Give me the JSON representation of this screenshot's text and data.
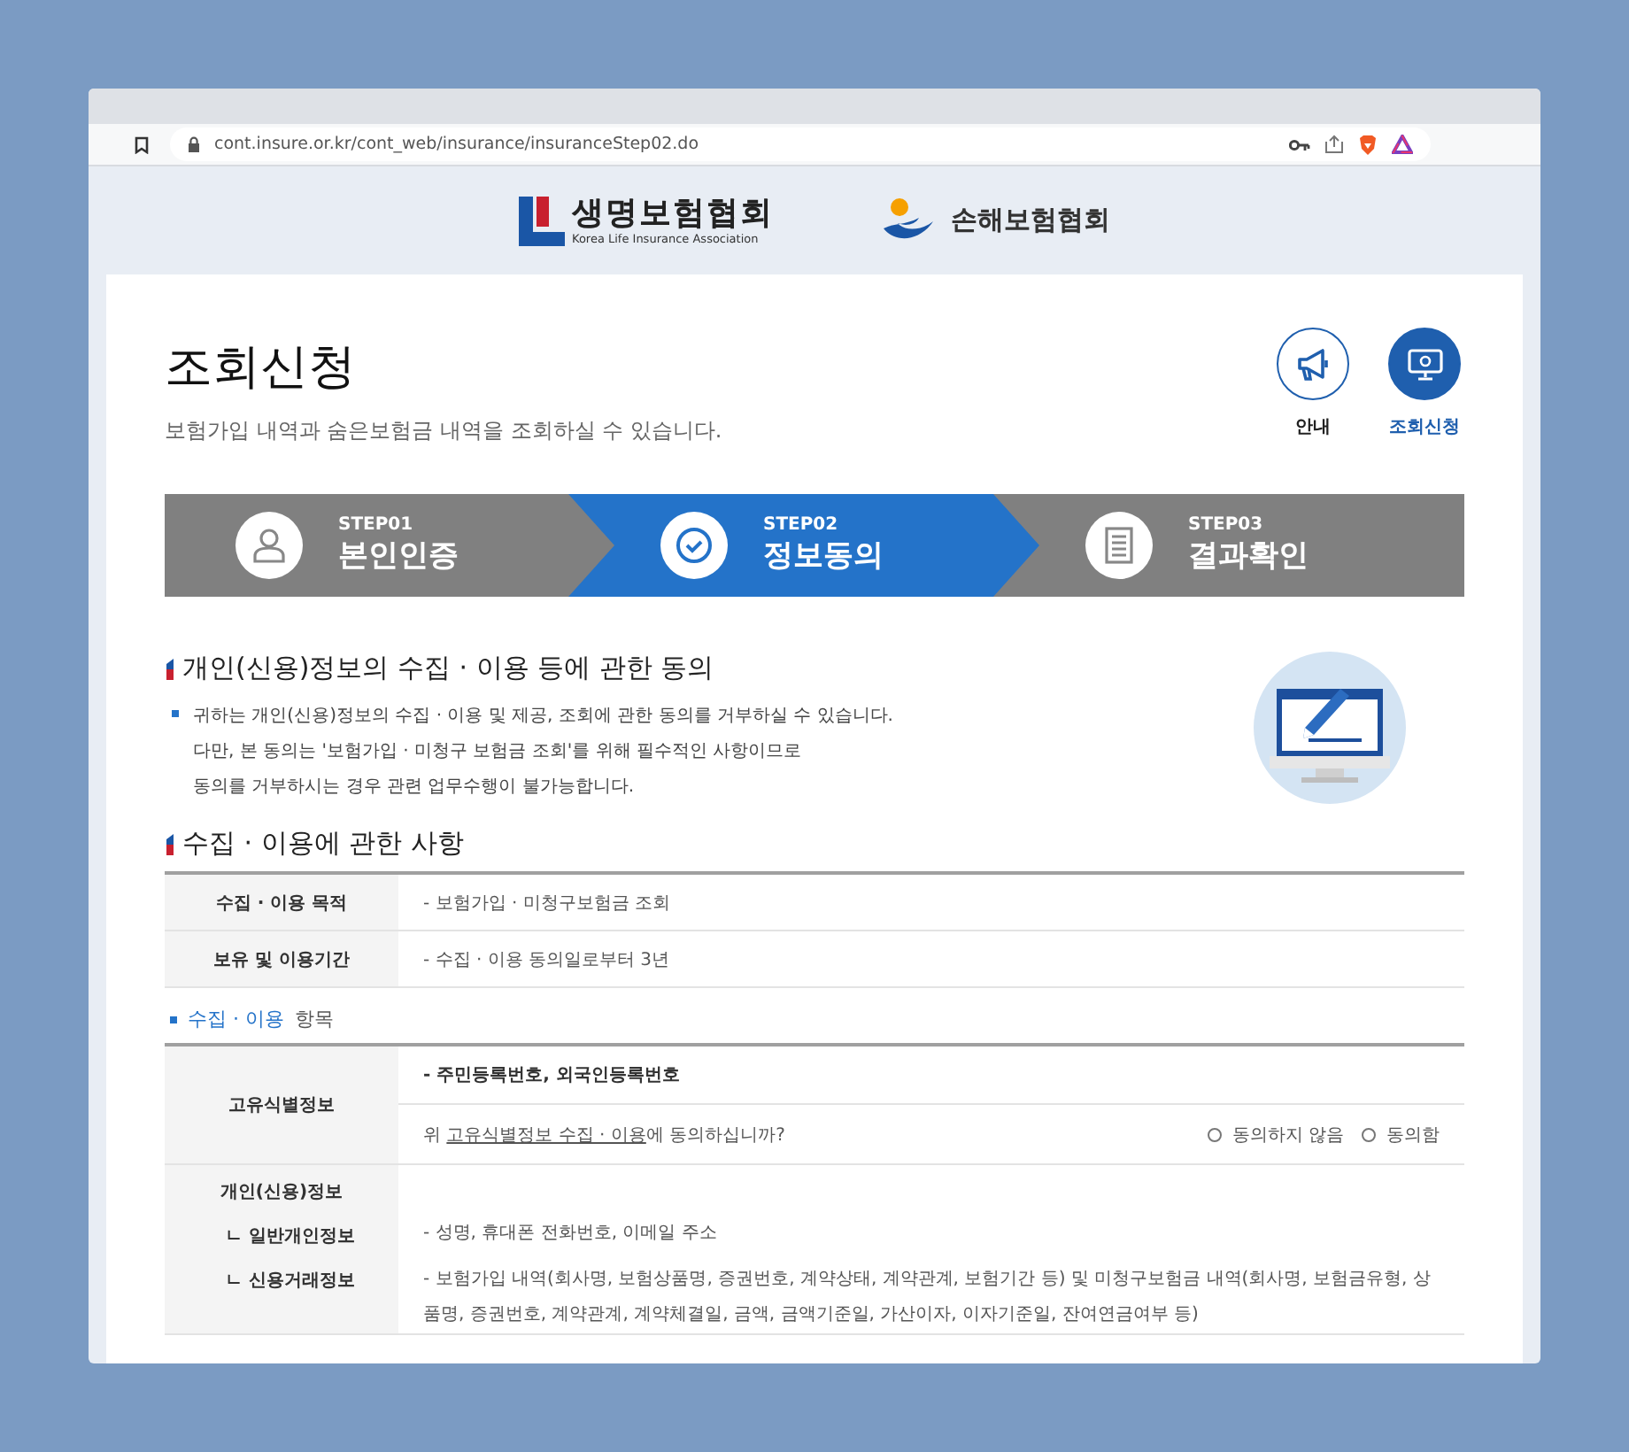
{
  "browser": {
    "url": "cont.insure.or.kr/cont_web/insurance/insuranceStep02.do"
  },
  "header": {
    "logos": [
      {
        "kind": "life",
        "name": "생명보험협회",
        "subtitle": "Korea Life Insurance Association"
      },
      {
        "kind": "nonlife",
        "name": "손해보험협회"
      }
    ]
  },
  "page": {
    "title": "조회신청",
    "subtitle": "보험가입 내역과 숨은보험금 내역을 조회하실 수 있습니다.",
    "shortcuts": [
      {
        "label": "안내",
        "kind": "megaphone",
        "selected": false
      },
      {
        "label": "조회신청",
        "kind": "monitor",
        "selected": true
      }
    ]
  },
  "steps": [
    {
      "number": "STEP01",
      "label": "본인인증",
      "kind": "person",
      "selected": false
    },
    {
      "number": "STEP02",
      "label": "정보동의",
      "kind": "check",
      "selected": true
    },
    {
      "number": "STEP03",
      "label": "결과확인",
      "kind": "document",
      "selected": false
    }
  ],
  "consent": {
    "heading": "개인(신용)정보의 수집 · 이용 등에 관한 동의",
    "notice_lines": [
      "귀하는 개인(신용)정보의 수집 · 이용 및 제공, 조회에 관한 동의를 거부하실 수 있습니다.",
      "다만, 본 동의는 '보험가입 · 미청구 보험금 조회'를 위해 필수적인 사항이므로",
      "동의를 거부하시는 경우 관련 업무수행이 불가능합니다."
    ]
  },
  "usage": {
    "heading": "수집 · 이용에 관한 사항",
    "rows": [
      {
        "label": "수집 · 이용 목적",
        "value": "- 보험가입 · 미청구보험금 조회"
      },
      {
        "label": "보유 및 이용기간",
        "value": "- 수집 · 이용 동의일로부터 3년"
      }
    ]
  },
  "items": {
    "heading_highlight": "수집 · 이용",
    "heading_rest": "항목",
    "unique": {
      "label": "고유식별정보",
      "value": "- 주민등록번호, 외국인등록번호",
      "question_prefix": "위",
      "question_link": "고유식별정보 수집 · 이용",
      "question_suffix": "에 동의하십니까?",
      "options": [
        {
          "label": "동의하지 않음",
          "selected": false
        },
        {
          "label": "동의함",
          "selected": false
        }
      ]
    },
    "personal": {
      "label": "개인(신용)정보",
      "subrows": [
        {
          "marker": "ㄴ",
          "label": "일반개인정보",
          "value": "- 성명, 휴대폰 전화번호, 이메일 주소"
        },
        {
          "marker": "ㄴ",
          "label": "신용거래정보",
          "value": "- 보험가입 내역(회사명, 보험상품명, 증권번호, 계약상태, 계약관계, 보험기간 등) 및 미청구보험금 내역(회사명, 보험금유형, 상품명, 증권번호, 계약관계, 계약체결일, 금액, 금액기준일, 가산이자, 이자기준일, 잔여연금여부 등)"
        }
      ]
    }
  }
}
